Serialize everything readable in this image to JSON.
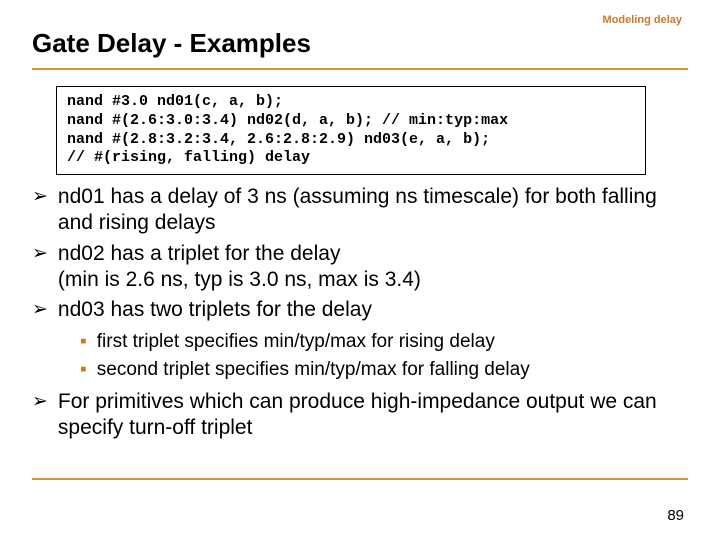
{
  "topic": "Modeling delay",
  "title": "Gate Delay - Examples",
  "code": {
    "l1": "nand #3.0 nd01(c, a, b);",
    "l2": "nand #(2.6:3.0:3.4) nd02(d, a, b); // min:typ:max",
    "l3": "nand #(2.8:3.2:3.4, 2.6:2.8:2.9) nd03(e, a, b);",
    "l4": "// #(rising, falling) delay"
  },
  "bullets": {
    "m1": "➢",
    "m2": "▪",
    "i1": "nd01 has a delay of 3 ns (assuming ns timescale) for both falling and rising delays",
    "i2": "nd02 has a triplet for the delay\n(min is 2.6 ns, typ is 3.0 ns, max is 3.4)",
    "i3": "nd03 has two triplets for the delay",
    "i3a": "first triplet specifies min/typ/max for rising delay",
    "i3b": "second triplet specifies min/typ/max for falling delay",
    "i4": "For primitives which can produce high-impedance output we can specify turn-off triplet"
  },
  "pagenum": "89"
}
